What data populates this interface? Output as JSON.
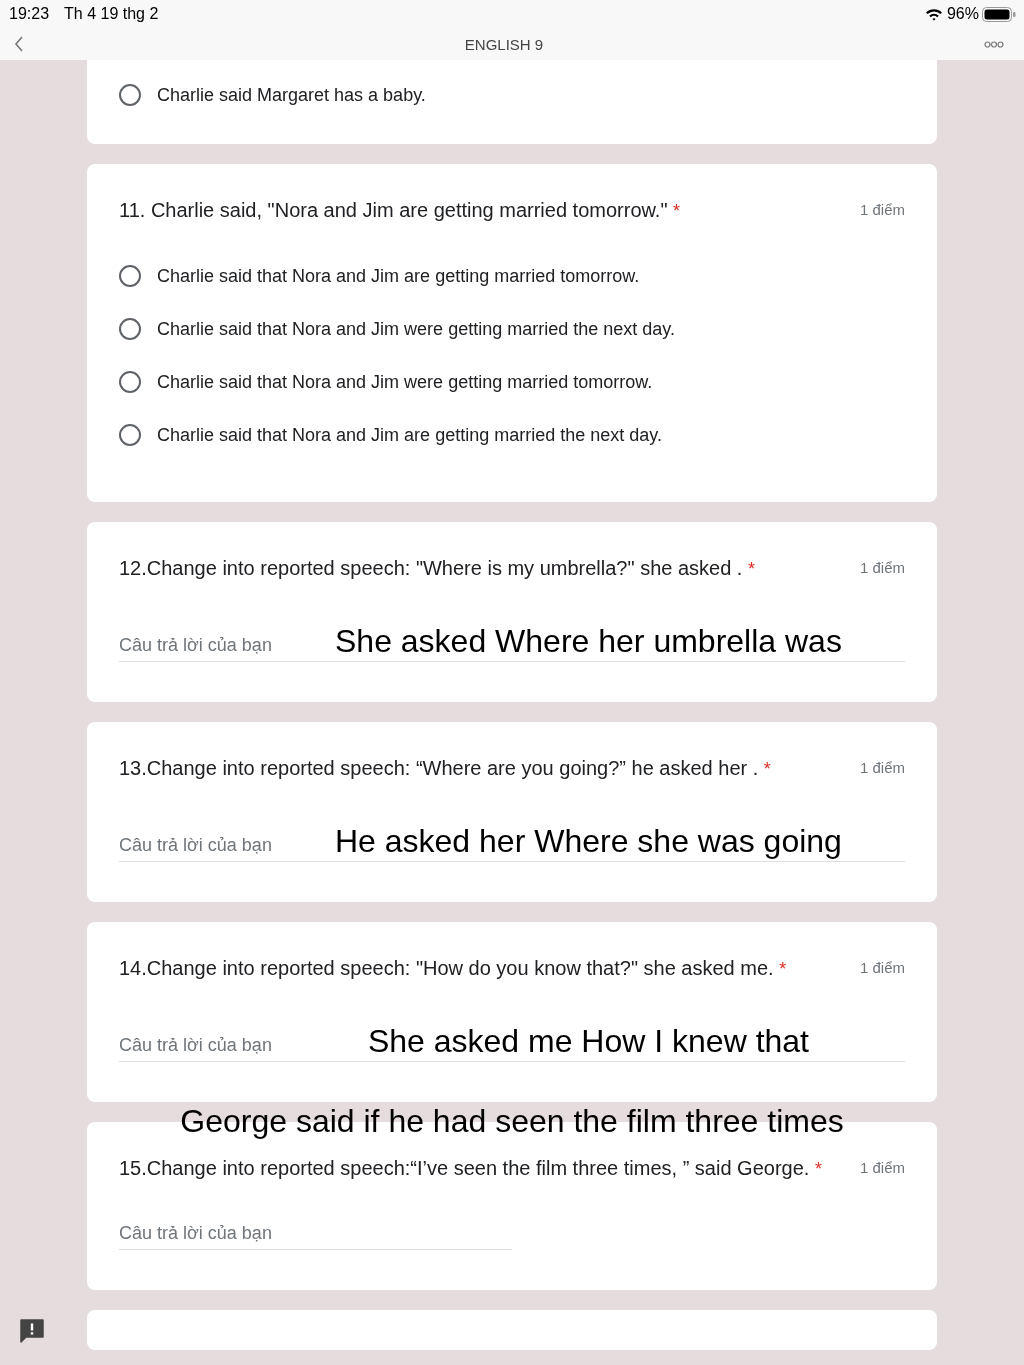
{
  "status_bar": {
    "time": "19:23",
    "date": "Th 4 19 thg 2",
    "battery": "96%"
  },
  "nav": {
    "title": "ENGLISH 9"
  },
  "questions": [
    {
      "kind": "choice",
      "options": [
        {
          "label": "Charlie said Margaret has a baby.",
          "selected": false
        }
      ]
    },
    {
      "kind": "choice",
      "title": "11. Charlie said, \"Nora and Jim are getting married tomorrow.\"",
      "required_mark": "*",
      "points": "1 điểm",
      "options": [
        {
          "label": "Charlie said that Nora and Jim are getting married tomorrow.",
          "selected": false
        },
        {
          "label": "Charlie said that Nora and Jim were getting married the next day.",
          "selected": false
        },
        {
          "label": "Charlie said that Nora and Jim were getting married tomorrow.",
          "selected": false
        },
        {
          "label": "Charlie said that Nora and Jim are getting married the next day.",
          "selected": false
        }
      ]
    },
    {
      "kind": "text",
      "title": "12.Change into reported speech: \"Where is my umbrella?\" she asked .",
      "required_mark": "*",
      "points": "1 điểm",
      "placeholder": "Câu trả lời của bạn",
      "annotation": {
        "kind": "inline",
        "text": "She asked Where her umbrella was"
      }
    },
    {
      "kind": "text",
      "title": "13.Change into reported speech: “Where are you going?” he asked her .",
      "required_mark": "*",
      "points": "1 điểm",
      "placeholder": "Câu trả lời của bạn",
      "annotation": {
        "kind": "inline",
        "text": "He asked her Where she was going"
      }
    },
    {
      "kind": "text",
      "title": "14.Change into reported speech: \"How do you know that?\" she asked me.",
      "required_mark": "*",
      "points": "1 điểm",
      "placeholder": "Câu trả lời của bạn",
      "annotation": {
        "kind": "inline",
        "text": "She asked me How I knew that"
      }
    },
    {
      "kind": "text",
      "title": "15.Change into reported speech:“I’ve seen the film three times, ” said George.",
      "required_mark": "*",
      "points": "1 điểm",
      "placeholder": "Câu trả lời của bạn",
      "annotation": {
        "kind": "above",
        "text": "George said if he had seen the film three times"
      }
    },
    {
      "kind": "empty"
    }
  ]
}
